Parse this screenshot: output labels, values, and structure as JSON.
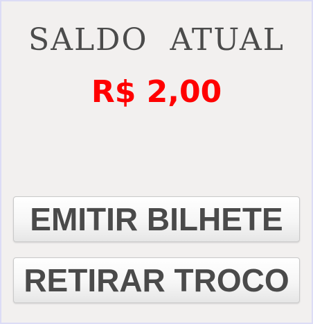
{
  "balance_panel": {
    "title": "SALDO  ATUAL",
    "amount": "R$ 2,00"
  },
  "actions": {
    "emit_ticket_label": "EMITIR BILHETE",
    "withdraw_change_label": "RETIRAR TROCO"
  },
  "colors": {
    "amount": "#ff0000",
    "title": "#4b4b4b",
    "background": "#f2f0ef",
    "border": "#dcdcf6"
  }
}
